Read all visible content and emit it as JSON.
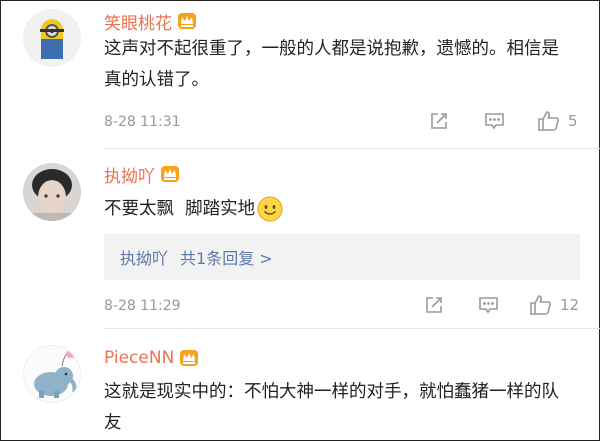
{
  "comments": [
    {
      "username": "笑眼桃花",
      "text": "这声对不起很重了，一般的人都是说抱歉，遗憾的。相信是真的认错了。",
      "time": "8-28 11:31",
      "likes": "5"
    },
    {
      "username": "执拗吖",
      "text": "不要太飘  脚踏实地",
      "emoji": "smile-emoji",
      "reply": {
        "author": "执拗吖",
        "summary": "共1条回复 >"
      },
      "time": "8-28 11:29",
      "likes": "12"
    },
    {
      "username": "PieceNN",
      "text": "这就是现实中的：不怕大神一样的对手，就怕蠢猪一样的队友"
    }
  ],
  "icons": [
    "repost-icon",
    "comment-icon",
    "like-icon",
    "vip-crown-icon"
  ],
  "colors": {
    "username": "#eb7350",
    "reply_link": "#5b7aa8",
    "meta": "#999999"
  }
}
